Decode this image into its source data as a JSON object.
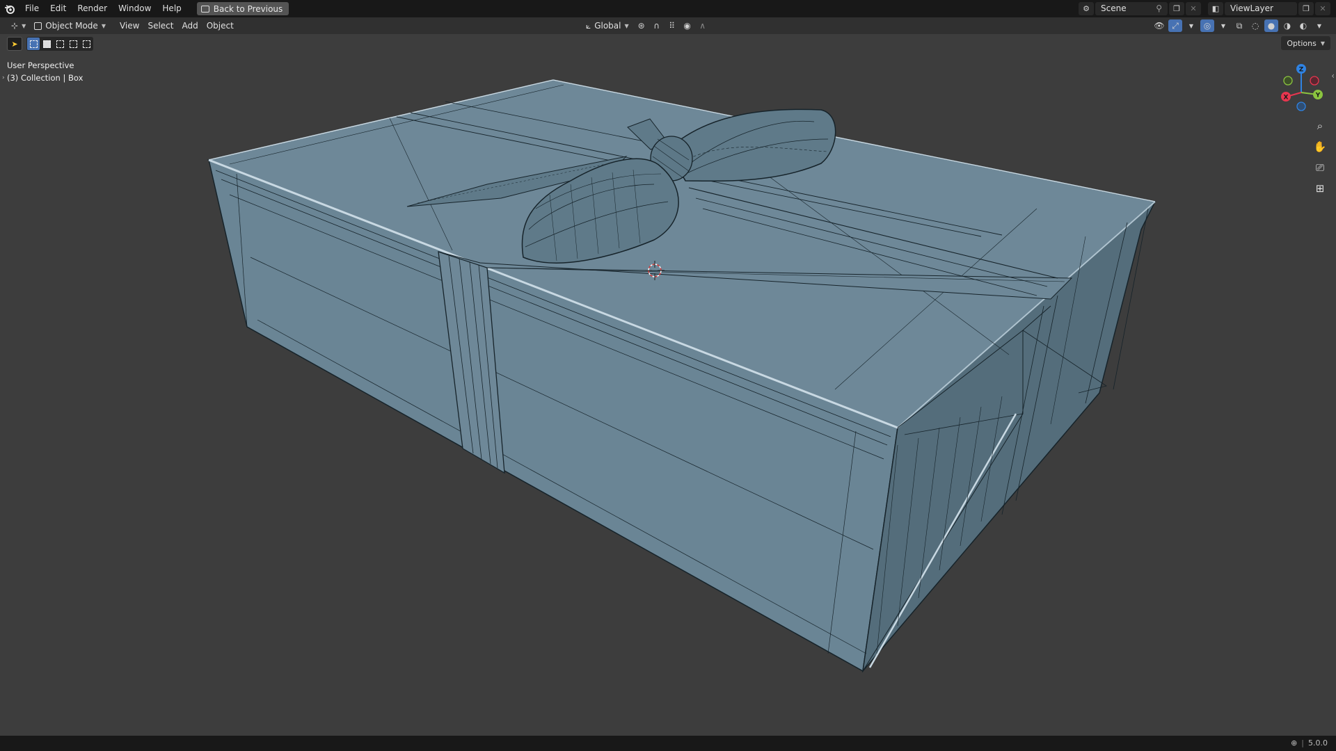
{
  "topbar": {
    "menus": [
      "File",
      "Edit",
      "Render",
      "Window",
      "Help"
    ],
    "back_label": "Back to Previous",
    "scene_label": "Scene",
    "viewlayer_label": "ViewLayer"
  },
  "header": {
    "mode_label": "Object Mode",
    "menus": [
      "View",
      "Select",
      "Add",
      "Object"
    ],
    "orientation_label": "Global",
    "options_label": "Options"
  },
  "viewport": {
    "perspective_label": "User Perspective",
    "collection_label": "(3) Collection | Box"
  },
  "gizmo": {
    "x_label": "X",
    "y_label": "Y",
    "z_label": "Z",
    "x_color": "#e8364f",
    "y_color": "#8bc43f",
    "z_color": "#2f83e3"
  },
  "status": {
    "version": "5.0.0"
  },
  "colors": {
    "mesh_face": "#6c8696",
    "wire": "#1a252c",
    "bg": "#3d3d3d"
  }
}
